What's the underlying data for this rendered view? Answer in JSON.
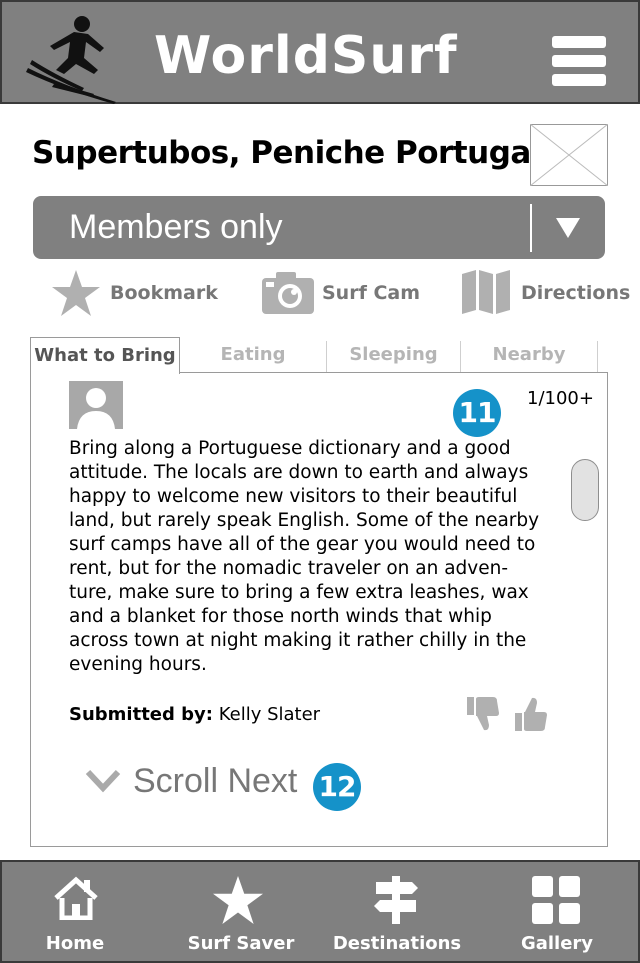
{
  "header": {
    "brand": "WorldSurf",
    "logo_icon": "surfer-icon",
    "menu_icon": "hamburger-menu-icon"
  },
  "spot": {
    "title": "Supertubos, Peniche Portugal",
    "photo_icon": "image-placeholder-icon"
  },
  "dropdown": {
    "selected": "Members only",
    "arrow_icon": "triangle-down-icon"
  },
  "actions": [
    {
      "label": "Bookmark",
      "icon": "star-icon"
    },
    {
      "label": "Surf Cam",
      "icon": "camera-icon"
    },
    {
      "label": "Directions",
      "icon": "map-icon"
    }
  ],
  "tabs": [
    {
      "label": "What to Bring",
      "active": true
    },
    {
      "label": "Eating",
      "active": false
    },
    {
      "label": "Sleeping",
      "active": false
    },
    {
      "label": "Nearby",
      "active": false
    }
  ],
  "post": {
    "badge_top": "11",
    "count": "1/100+",
    "text": "Bring along a Portuguese dictionary and a good\nattitude. The locals are down to earth and always\nhappy to welcome new visitors to their beautiful\nland, but rarely speak English. Some of the nearby\nsurf camps have all of the gear you would need to\nrent, but for the nomadic traveler on an adven-\nture, make sure to bring a few extra leashes, wax\nand a blanket for those north winds that whip\nacross town at night making it rather chilly in the\nevening hours.",
    "submitted_label": "Submitted by:",
    "submitted_by": "Kelly Slater",
    "scroll_next": "Scroll Next",
    "badge_bottom": "12"
  },
  "bottom_nav": [
    {
      "label": "Home",
      "icon": "home-icon"
    },
    {
      "label": "Surf Saver",
      "icon": "star-icon"
    },
    {
      "label": "Destinations",
      "icon": "signpost-icon"
    },
    {
      "label": "Gallery",
      "icon": "grid-icon"
    }
  ],
  "colors": {
    "bar": "#808080",
    "accent_badge": "#1592c9",
    "muted_icon": "#b0b0b0"
  }
}
